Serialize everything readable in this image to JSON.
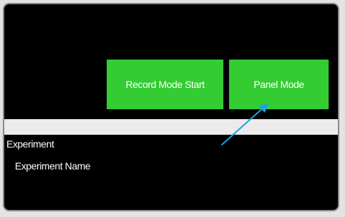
{
  "buttons": {
    "record_mode_start": "Record Mode Start",
    "panel_mode": "Panel Mode"
  },
  "tree": {
    "root_label": "Experiment",
    "child_label": "Experiment Name"
  },
  "colors": {
    "panel_background": "#000000",
    "button_green": "#33cc33",
    "annotation_arrow": "#1ea0e6"
  }
}
